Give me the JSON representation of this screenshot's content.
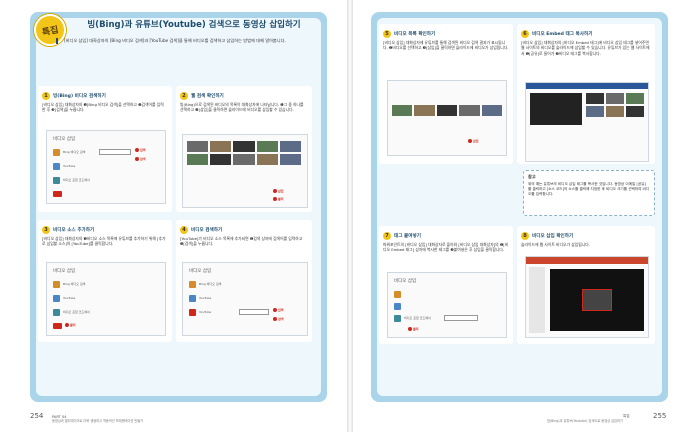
{
  "left_page": {
    "tag": "특집",
    "title": "빙(Bing)과 유튜브(Youtube) 검색으로 동영상 삽입하기",
    "intro": "[비디오 삽입] 대화상자의 [Bing 비디오 검색]과 [YouTube 검색]을 통해 비디오를 검색하고 삽입하는 방법에 대해 알아봅니다.",
    "steps": [
      {
        "num": "1",
        "title": "빙(Bing) 비디오 검색하기",
        "desc": "[비디오 삽입] 대화상자의 ❶[Bing 비디오 검색]을 선택하고 ❷검색어를 입력한 후 ❸[검색]을 누릅니다."
      },
      {
        "num": "2",
        "title": "웹 검색 확인하기",
        "desc": "빙(Bing)으로 검색된 비디오의 목록이 대화상자에 나타납니다. ❶그 중 하나를 선택하고 ❷[삽입]을 클릭하면 슬라이드에 비디오를 삽입할 수 있습니다."
      },
      {
        "num": "3",
        "title": "비디오 소스 추가하기",
        "desc": "[비디오 삽입] 대화상자의 ❶비디오 소스 목록에 유튜브를 추가하기 위해 [추가로 삽입할 소스]의 [YouTube]를 클릭합니다."
      },
      {
        "num": "4",
        "title": "비디오 검색하기",
        "desc": "[YouTube]가 비디오 소스 목록에 추가되면 ❶검색 상자에 검색어를 입력하고 ❷[검색]을 누릅니다."
      }
    ],
    "dialog_title": "비디오 삽입",
    "dialog_rows": [
      "Bing 비디오 검색",
      "YouTube",
      "비디오 포함 코드에서"
    ],
    "callouts": {
      "search": "검색",
      "input": "입력",
      "insert": "삽입",
      "click": "클릭"
    },
    "folio_num": "254",
    "folio_part": "PART 04",
    "folio_sub": "동영상과 멀티미디어로 더욱 생생하고 역동적인 프레젠테이션 만들기"
  },
  "right_page": {
    "steps": [
      {
        "num": "5",
        "title": "비디오 목록 확인하기",
        "desc": "[비디오 삽입] 대화상자에 유튜브를 통해 검색된 비디오 검색 결과가 표시됩니다. ❶비디오를 선택하고 ❷[삽입]을 클릭하면 슬라이드에 비디오가 삽입됩니다."
      },
      {
        "num": "6",
        "title": "비디오 Embed 태그 복사하기",
        "desc": "[비디오 삽입] 대화상자의 [비디오 Embed 태그]에 비디오 삽입 태그를 넣어주면 웹 사이트의 비디오를 슬라이드에 삽입할 수 있습니다. 유튜브가 있는 웹 사이트에서 ❶[공유]로 들어가 ❷비디오 태그를 복사합니다."
      },
      {
        "num": "7",
        "title": "태그 붙여넣기",
        "desc": "파워포인트의 [비디오 삽입] 대화상자로 돌아와 [비디오 삽입 대화상자]의 ❶[비디오 Embed 태그] 상자에 복사한 태그를 ❷붙여넣은 후 삽입을 클릭합니다."
      },
      {
        "num": "8",
        "title": "비디오 삽입 확인하기",
        "desc": "슬라이드에 웹 사이트 비디오가 삽입됩니다."
      }
    ],
    "tip_title": "참고",
    "tip_body": "위의 예는 유튜브의 비디오 삽입 태그를 복사한 것입니다. 동영상 이메일 [공유] 를 클릭하고 [소스 코드]의 소스를 클릭해 지정한 후 비디오 크기를 선택하여 비디오를 입력합니다.",
    "folio_num": "255",
    "folio_part": "특집",
    "folio_sub": "빙(Bing)과 유튜브(Youtube) 검색으로 동영상 삽입하기"
  }
}
